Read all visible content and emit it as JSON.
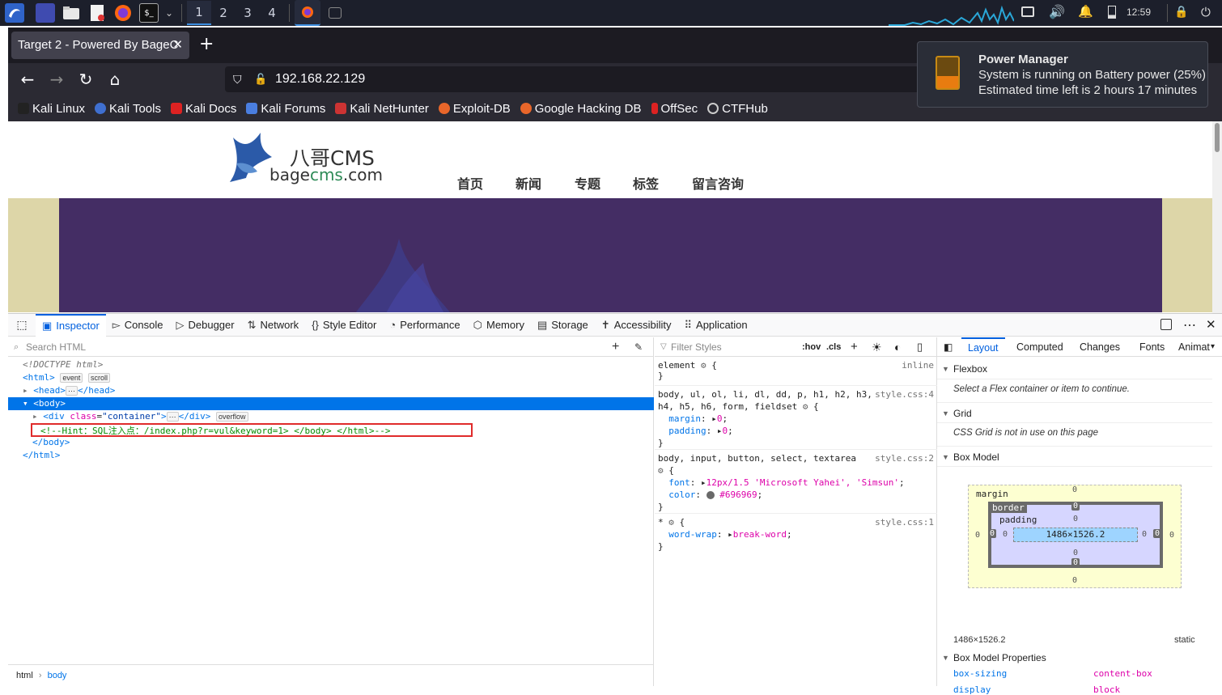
{
  "taskbar": {
    "workspaces": [
      "1",
      "2",
      "3",
      "4"
    ],
    "active_workspace": "1",
    "time": "12:59"
  },
  "browser": {
    "tab_title": "Target 2 - Powered By BageC",
    "url": "192.168.22.129",
    "bookmarks": [
      "Kali Linux",
      "Kali Tools",
      "Kali Docs",
      "Kali Forums",
      "Kali NetHunter",
      "Exploit-DB",
      "Google Hacking DB",
      "OffSec",
      "CTFHub"
    ]
  },
  "notification": {
    "title": "Power Manager",
    "line1": "System is running on Battery power (25%)",
    "line2": "Estimated time left is 2 hours 17 minutes"
  },
  "site": {
    "logo_cn": "八哥CMS",
    "logo_prefix": "bage",
    "logo_mid": "cms",
    "logo_suffix": ".com",
    "nav": [
      "首页",
      "新闻",
      "专题",
      "标签",
      "留言咨询"
    ]
  },
  "devtools": {
    "tabs": [
      "Inspector",
      "Console",
      "Debugger",
      "Network",
      "Style Editor",
      "Performance",
      "Memory",
      "Storage",
      "Accessibility",
      "Application"
    ],
    "search_placeholder": "Search HTML",
    "html": {
      "doctype": "<!DOCTYPE html>",
      "comment": "<!--Hint：SQL注入点：/index.php?r=vul&keyword=1> </body> </html>-->",
      "badges": [
        "event",
        "scroll",
        "overflow"
      ],
      "container_class": "container"
    },
    "breadcrumb": [
      "html",
      "body"
    ],
    "styles": {
      "filter_placeholder": "Filter Styles",
      "hov": ":hov",
      "cls": ".cls",
      "rules": [
        {
          "selector": "element",
          "source": "inline",
          "props": []
        },
        {
          "selector": "body, ul, ol, li, dl, dd, p, h1, h2, h3, h4, h5, h6, form, fieldset",
          "source": "style.css:4",
          "props": [
            {
              "name": "margin",
              "value": "0"
            },
            {
              "name": "padding",
              "value": "0"
            }
          ]
        },
        {
          "selector": "body, input, button, select, textarea",
          "source": "style.css:2",
          "props": [
            {
              "name": "font",
              "value": "12px/1.5 'Microsoft Yahei', 'Simsun'"
            },
            {
              "name": "color",
              "value": "#696969"
            }
          ]
        },
        {
          "selector": "*",
          "source": "style.css:1",
          "props": [
            {
              "name": "word-wrap",
              "value": "break-word"
            }
          ]
        }
      ]
    },
    "layout": {
      "tabs": [
        "Layout",
        "Computed",
        "Changes",
        "Fonts",
        "Animat"
      ],
      "flexbox_title": "Flexbox",
      "flexbox_note": "Select a Flex container or item to continue.",
      "grid_title": "Grid",
      "grid_note": "CSS Grid is not in use on this page",
      "boxmodel_title": "Box Model",
      "box_labels": {
        "margin": "margin",
        "border": "border",
        "padding": "padding"
      },
      "content_size": "1486×1526.2",
      "zero": "0",
      "position": "static",
      "props_title": "Box Model Properties",
      "props": [
        {
          "name": "box-sizing",
          "value": "content-box"
        },
        {
          "name": "display",
          "value": "block"
        }
      ]
    }
  }
}
